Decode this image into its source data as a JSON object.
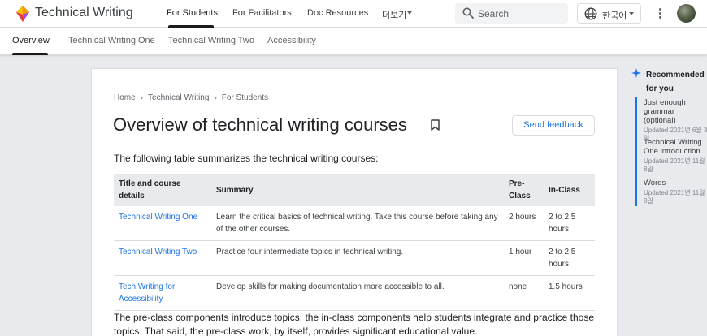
{
  "header": {
    "site_title": "Technical Writing",
    "nav": [
      {
        "label": "For Students",
        "active": true
      },
      {
        "label": "For Facilitators"
      },
      {
        "label": "Doc Resources"
      },
      {
        "label": "더보기"
      }
    ],
    "search_placeholder": "Search",
    "language": "한국어"
  },
  "subnav": [
    {
      "label": "Overview",
      "active": true
    },
    {
      "label": "Technical Writing One"
    },
    {
      "label": "Technical Writing Two"
    },
    {
      "label": "Accessibility"
    }
  ],
  "article": {
    "breadcrumb": [
      "Home",
      "Technical Writing",
      "For Students"
    ],
    "title": "Overview of technical writing courses",
    "feedback_label": "Send feedback",
    "intro": "The following table summarizes the technical writing courses:",
    "table": {
      "headers": [
        "Title and course details",
        "Summary",
        "Pre-Class",
        "In-Class"
      ],
      "rows": [
        {
          "title": "Technical Writing One",
          "summary": "Learn the critical basics of technical writing. Take this course before taking any of the other courses.",
          "pre": "2 hours",
          "in": "2 to 2.5 hours"
        },
        {
          "title": "Technical Writing Two",
          "summary": "Practice four intermediate topics in technical writing.",
          "pre": "1 hour",
          "in": "2 to 2.5 hours"
        },
        {
          "title": "Tech Writing for Accessibility",
          "summary": "Develop skills for making documentation more accessible to all.",
          "pre": "none",
          "in": "1.5 hours"
        }
      ]
    },
    "outro": "The pre-class components introduce topics; the in-class components help students integrate and practice those topics. That said, the pre-class work, by itself, provides significant educational value."
  },
  "sidebar": {
    "heading": "Recommended for you",
    "items": [
      {
        "title": "Just enough grammar (optional)",
        "updated": "Updated 2021년 6월 3일"
      },
      {
        "title": "Technical Writing One introduction",
        "updated": "Updated 2021년 11월 8일"
      },
      {
        "title": "Words",
        "updated": "Updated 2021년 11월 8일"
      }
    ]
  },
  "colors": {
    "link": "#1a73e8",
    "accent_bar": "#1a73e8",
    "background": "#e8eaed"
  },
  "icons": [
    "logo-icon",
    "search-icon",
    "globe-icon",
    "more-vert-icon",
    "bookmark-icon",
    "chevron-right-icon",
    "sparkle-icon"
  ]
}
